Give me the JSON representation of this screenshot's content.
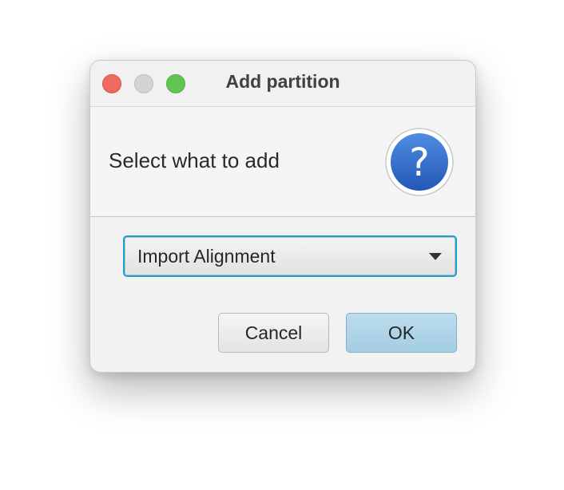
{
  "window": {
    "title": "Add partition",
    "controls": {
      "close": "close-button",
      "minimize": "minimize-button",
      "zoom": "zoom-button"
    }
  },
  "header": {
    "text": "Select what to add",
    "icon": "question-mark-icon",
    "icon_glyph": "?",
    "icon_color": "#2f6bc9"
  },
  "combo": {
    "selected": "Import Alignment",
    "focus_color": "#1c9fd3"
  },
  "buttons": {
    "cancel_label": "Cancel",
    "ok_label": "OK"
  }
}
